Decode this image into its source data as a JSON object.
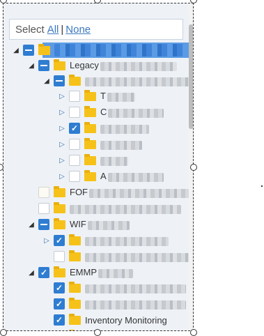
{
  "select_bar": {
    "label": "Select",
    "all": "All",
    "separator": "|",
    "none": "None"
  },
  "tree": [
    {
      "state": "partial",
      "arrow": "open",
      "text": "",
      "redacted": true,
      "selected": true
    },
    {
      "state": "partial",
      "arrow": "open",
      "text": "Legacy",
      "redacted": true
    },
    {
      "state": "partial",
      "arrow": "open",
      "text": "",
      "redacted": true
    },
    {
      "state": "empty",
      "arrow": "closed",
      "text": "T",
      "redacted": true
    },
    {
      "state": "empty",
      "arrow": "closed",
      "text": "C",
      "redacted": true
    },
    {
      "state": "checked",
      "arrow": "closed",
      "text": "",
      "redacted": true
    },
    {
      "state": "empty",
      "arrow": "closed",
      "text": "",
      "redacted": true
    },
    {
      "state": "empty",
      "arrow": "closed",
      "text": "",
      "redacted": true
    },
    {
      "state": "empty",
      "arrow": "closed",
      "text": "A",
      "redacted": true
    },
    {
      "state": "empty",
      "arrow": "none",
      "text": "FOF",
      "redacted": true
    },
    {
      "state": "empty",
      "arrow": "none",
      "text": "",
      "redacted": true
    },
    {
      "state": "partial",
      "arrow": "open",
      "text": "WIF",
      "redacted": true
    },
    {
      "state": "checked",
      "arrow": "closed",
      "text": "",
      "redacted": true
    },
    {
      "state": "empty",
      "arrow": "none",
      "text": "",
      "redacted": true
    },
    {
      "state": "checked",
      "arrow": "open",
      "text": "EMMP",
      "redacted": true
    },
    {
      "state": "checked",
      "arrow": "none",
      "text": "",
      "redacted": true
    },
    {
      "state": "checked",
      "arrow": "none",
      "text": "",
      "redacted": true
    },
    {
      "state": "checked",
      "arrow": "none",
      "text": "Inventory Monitoring",
      "redacted": false
    },
    {
      "state": "empty",
      "arrow": "none",
      "text": "",
      "redacted": true
    }
  ]
}
